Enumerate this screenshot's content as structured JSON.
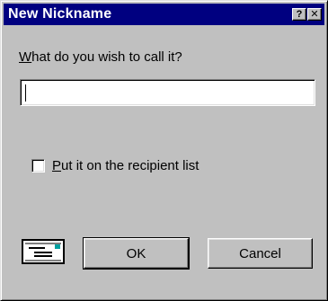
{
  "window": {
    "title": "New Nickname",
    "help_glyph": "?",
    "close_glyph": "✕"
  },
  "prompt": {
    "accel": "W",
    "rest": "hat do you wish to call it?"
  },
  "name_input": {
    "value": "",
    "placeholder": ""
  },
  "recipient_checkbox": {
    "checked": false,
    "accel": "P",
    "rest": "ut it on the recipient list"
  },
  "icons": {
    "envelope": "envelope-icon"
  },
  "buttons": {
    "ok": "OK",
    "cancel": "Cancel"
  },
  "colors": {
    "titlebar": "#000080",
    "face": "#c0c0c0"
  }
}
